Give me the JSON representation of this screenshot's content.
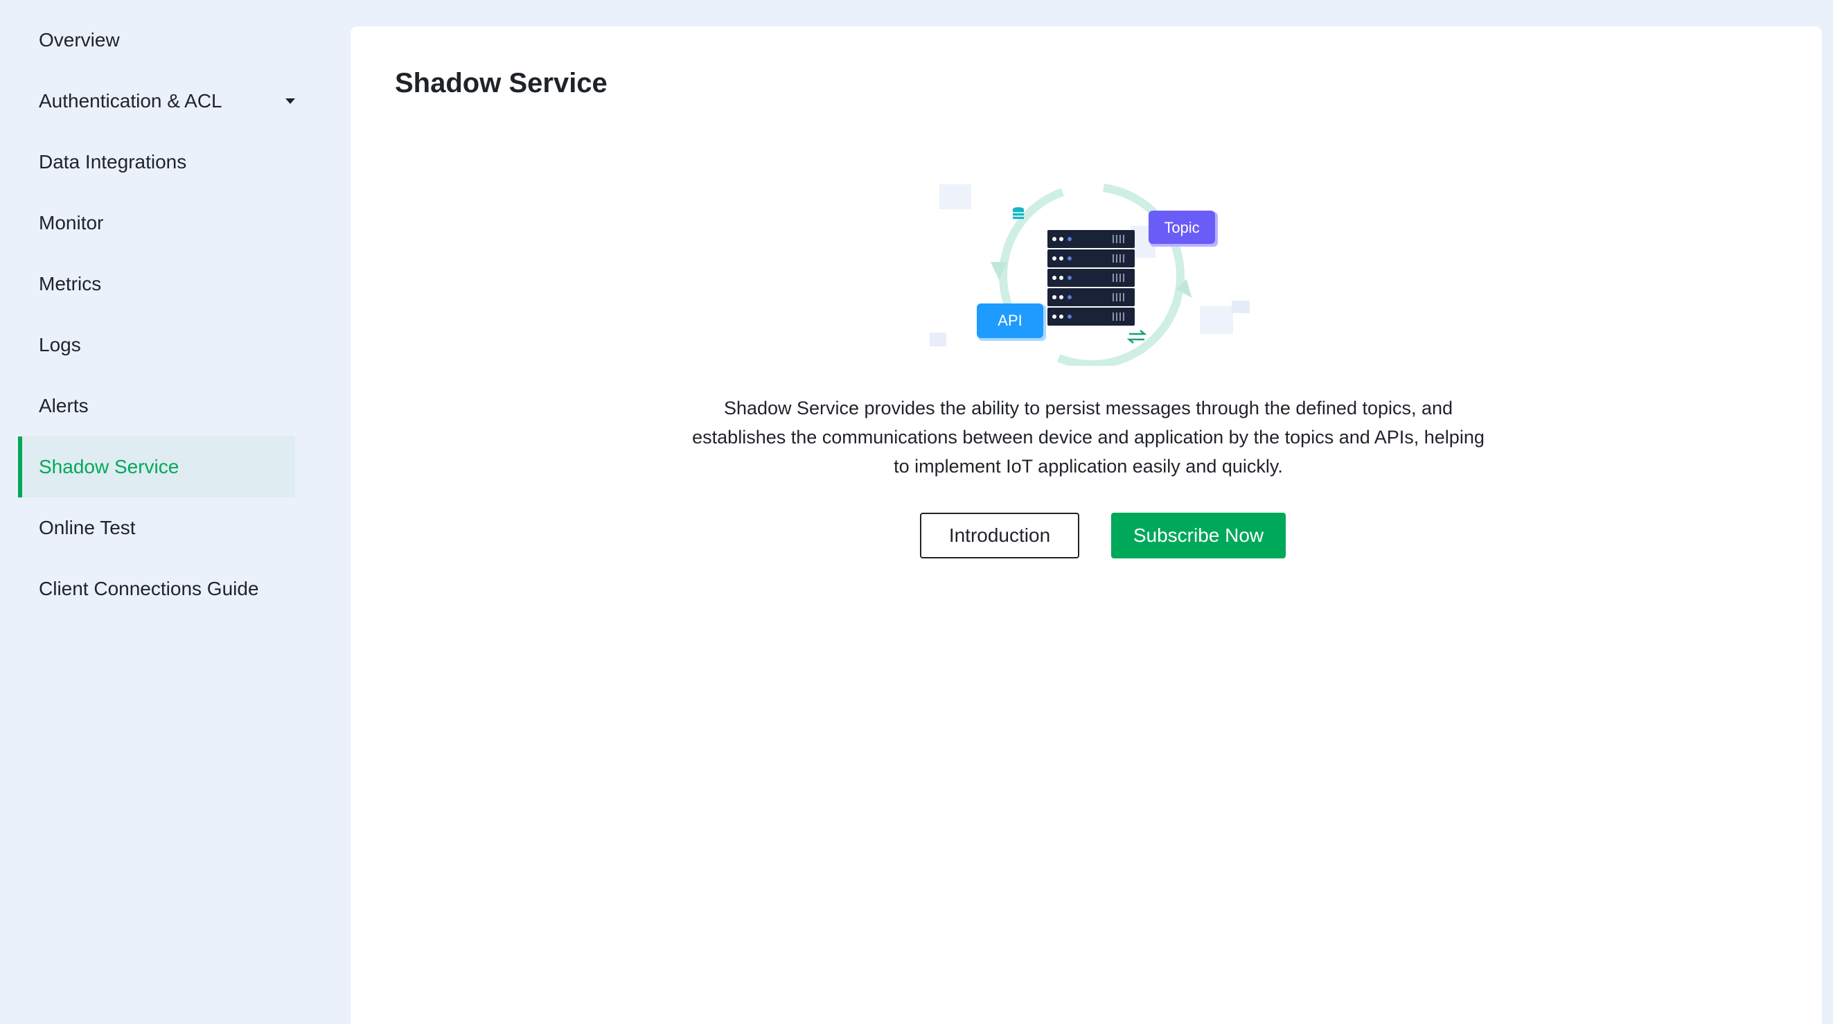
{
  "sidebar": {
    "items": [
      {
        "label": "Overview"
      },
      {
        "label": "Authentication & ACL"
      },
      {
        "label": "Data Integrations"
      },
      {
        "label": "Monitor"
      },
      {
        "label": "Metrics"
      },
      {
        "label": "Logs"
      },
      {
        "label": "Alerts"
      },
      {
        "label": "Shadow Service"
      },
      {
        "label": "Online Test"
      },
      {
        "label": "Client Connections Guide"
      }
    ],
    "active_item": "Shadow Service"
  },
  "main": {
    "title": "Shadow Service",
    "illustration": {
      "api_label": "API",
      "topic_label": "Topic"
    },
    "description": "Shadow Service provides the ability to persist messages through the defined topics, and establishes the communications between device and application by the topics and APIs, helping to implement IoT application easily and quickly.",
    "buttons": {
      "introduction": "Introduction",
      "subscribe": "Subscribe Now"
    }
  },
  "colors": {
    "accent": "#00a85a",
    "sidebar_bg": "#ebf1fa",
    "active_bg": "#dfecf1",
    "api_badge": "#1e9bff",
    "topic_badge": "#6a5cf6"
  }
}
